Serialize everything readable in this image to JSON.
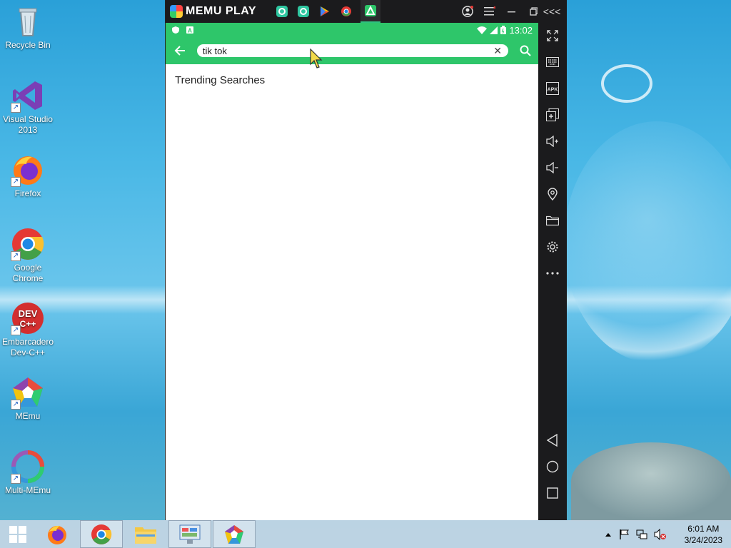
{
  "desktop": {
    "icons": [
      {
        "label": "Recycle Bin"
      },
      {
        "label": "Visual Studio 2013"
      },
      {
        "label": "Firefox"
      },
      {
        "label": "Google Chrome"
      },
      {
        "label": "Embarcadero Dev-C++"
      },
      {
        "label": "MEmu"
      },
      {
        "label": "Multi-MEmu"
      }
    ]
  },
  "memu": {
    "brand": "MEMU PLAY",
    "expand_label": "<<<",
    "status_bar": {
      "time": "13:02"
    },
    "search": {
      "value": "tik tok",
      "clear_label": "✕"
    },
    "section_title": "Trending Searches"
  },
  "taskbar": {
    "clock_time": "6:01 AM",
    "clock_date": "3/24/2023"
  },
  "colors": {
    "accent_green": "#2ec66a",
    "memu_chrome": "#1b1b1d"
  }
}
